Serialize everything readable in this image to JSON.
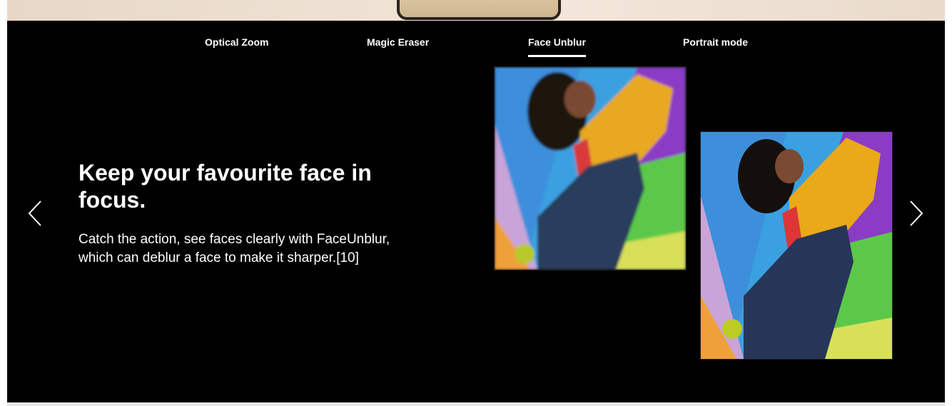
{
  "tabs": [
    {
      "label": "Optical Zoom",
      "active": false
    },
    {
      "label": "Magic Eraser",
      "active": false
    },
    {
      "label": "Face Unblur",
      "active": true
    },
    {
      "label": "Portrait mode",
      "active": false
    }
  ],
  "feature": {
    "headline": "Keep your favourite face in focus.",
    "description": "Catch the action, see faces clearly with FaceUnblur, which can deblur a face to make it sharper.[10]"
  },
  "navigation": {
    "prev_icon": "chevron-left-icon",
    "next_icon": "chevron-right-icon"
  },
  "images": {
    "before_alt": "person-jumping-blurred",
    "after_alt": "person-jumping-sharp"
  },
  "colors": {
    "background": "#000000",
    "text": "#ffffff",
    "accent_underline": "#ffffff"
  }
}
